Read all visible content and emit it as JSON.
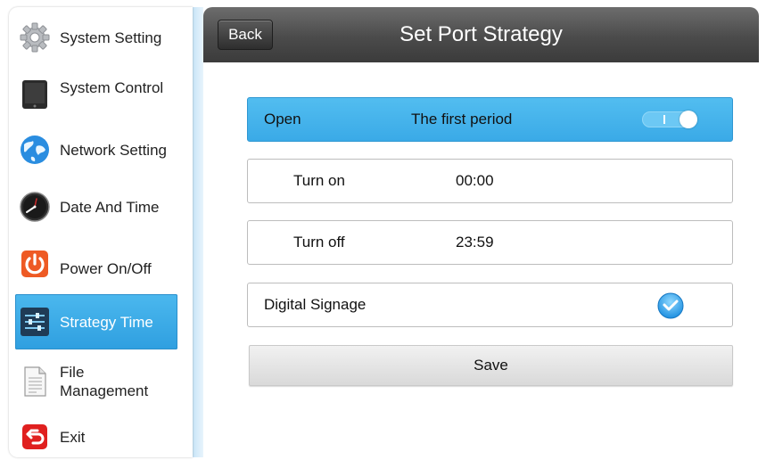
{
  "sidebar": {
    "items": [
      {
        "label": "System Setting",
        "icon": "gear-icon"
      },
      {
        "label": "System Control",
        "icon": "tablet-icon"
      },
      {
        "label": "Network Setting",
        "icon": "globe-icon"
      },
      {
        "label": "Date And Time",
        "icon": "clock-icon"
      },
      {
        "label": "Power On/Off",
        "icon": "power-icon"
      },
      {
        "label": "Strategy Time",
        "icon": "sliders-icon",
        "active": true
      },
      {
        "label_line1": "File",
        "label_line2": "Management",
        "icon": "document-icon"
      },
      {
        "label": "Exit",
        "icon": "exit-icon"
      }
    ]
  },
  "header": {
    "back_label": "Back",
    "title": "Set Port Strategy"
  },
  "period_row": {
    "status": "Open",
    "title": "The first period",
    "toggle_on": true
  },
  "turn_on": {
    "label": "Turn on",
    "value": "00:00"
  },
  "turn_off": {
    "label": "Turn off",
    "value": "23:59"
  },
  "signage": {
    "label": "Digital Signage",
    "checked": true
  },
  "save_label": "Save",
  "colors": {
    "accent": "#3aaae7",
    "header": "#4b4b4b",
    "save_button": "#e5e5e5"
  }
}
